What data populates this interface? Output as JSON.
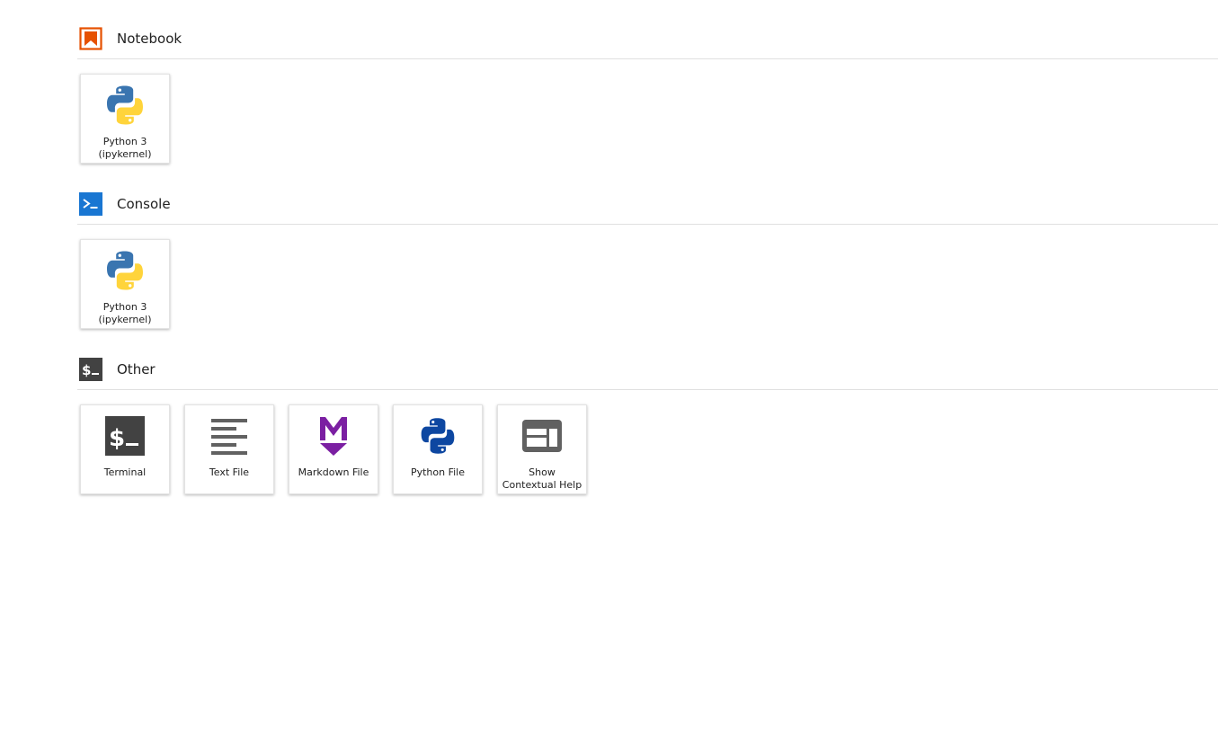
{
  "colors": {
    "notebook_icon": "#e65100",
    "console_icon": "#1976d2",
    "other_icon": "#424242",
    "markdown_icon": "#7b1fa2",
    "python_file_icon": "#0d47a1"
  },
  "sections": {
    "notebook": {
      "title": "Notebook",
      "icon": "notebook-bookmark-icon",
      "cards": [
        {
          "label": "Python 3 (ipykernel)",
          "icon": "python-logo-icon"
        }
      ]
    },
    "console": {
      "title": "Console",
      "icon": "console-prompt-icon",
      "cards": [
        {
          "label": "Python 3 (ipykernel)",
          "icon": "python-logo-icon"
        }
      ]
    },
    "other": {
      "title": "Other",
      "icon": "terminal-icon",
      "cards": [
        {
          "label": "Terminal",
          "icon": "terminal-icon"
        },
        {
          "label": "Text File",
          "icon": "text-file-icon"
        },
        {
          "label": "Markdown File",
          "icon": "markdown-icon"
        },
        {
          "label": "Python File",
          "icon": "python-file-icon"
        },
        {
          "label": "Show Contextual Help",
          "icon": "contextual-help-icon"
        }
      ]
    }
  }
}
